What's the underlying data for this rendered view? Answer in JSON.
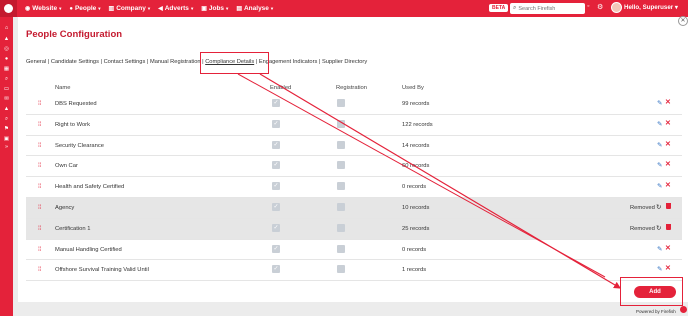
{
  "nav": {
    "items": [
      {
        "label": "Website",
        "icon": "globe-icon",
        "glyph": "◉"
      },
      {
        "label": "People",
        "icon": "person-icon",
        "glyph": "●"
      },
      {
        "label": "Company",
        "icon": "building-icon",
        "glyph": "▥"
      },
      {
        "label": "Adverts",
        "icon": "megaphone-icon",
        "glyph": "◀"
      },
      {
        "label": "Jobs",
        "icon": "briefcase-icon",
        "glyph": "▣"
      },
      {
        "label": "Analyse",
        "icon": "chart-icon",
        "glyph": "▤"
      }
    ],
    "beta": "BETA",
    "search_placeholder": "Search Firefish",
    "hello": "Hello, Superuser",
    "accent": "#e4223a"
  },
  "page": {
    "title": "People Configuration",
    "tabs": [
      {
        "label": "General",
        "active": false
      },
      {
        "label": "Candidate Settings",
        "active": false
      },
      {
        "label": "Contact Settings",
        "active": false
      },
      {
        "label": "Manual Registration",
        "active": false
      },
      {
        "label": "Compliance Details",
        "active": true
      },
      {
        "label": "Engagement Indicators",
        "active": false
      },
      {
        "label": "Supplier Directory",
        "active": false
      }
    ]
  },
  "table": {
    "headers": {
      "name": "Name",
      "enabled": "Enabled",
      "registration": "Registration",
      "used_by": "Used By"
    },
    "rows": [
      {
        "name": "DBS Requested",
        "used_by": "99 records",
        "removed": false
      },
      {
        "name": "Right to Work",
        "used_by": "122 records",
        "removed": false
      },
      {
        "name": "Security Clearance",
        "used_by": "14 records",
        "removed": false
      },
      {
        "name": "Own Car",
        "used_by": "60 records",
        "removed": false
      },
      {
        "name": "Health and Safety Certified",
        "used_by": "0 records",
        "removed": false
      },
      {
        "name": "Agency",
        "used_by": "10 records",
        "removed": true
      },
      {
        "name": "Certification 1",
        "used_by": "25 records",
        "removed": true
      },
      {
        "name": "Manual Handling Certified",
        "used_by": "0 records",
        "removed": false
      },
      {
        "name": "Offshore Survival Training Valid Until",
        "used_by": "1 records",
        "removed": false
      }
    ],
    "removed_label": "Removed"
  },
  "add_label": "Add",
  "powered_by": "Powered by Firefish"
}
